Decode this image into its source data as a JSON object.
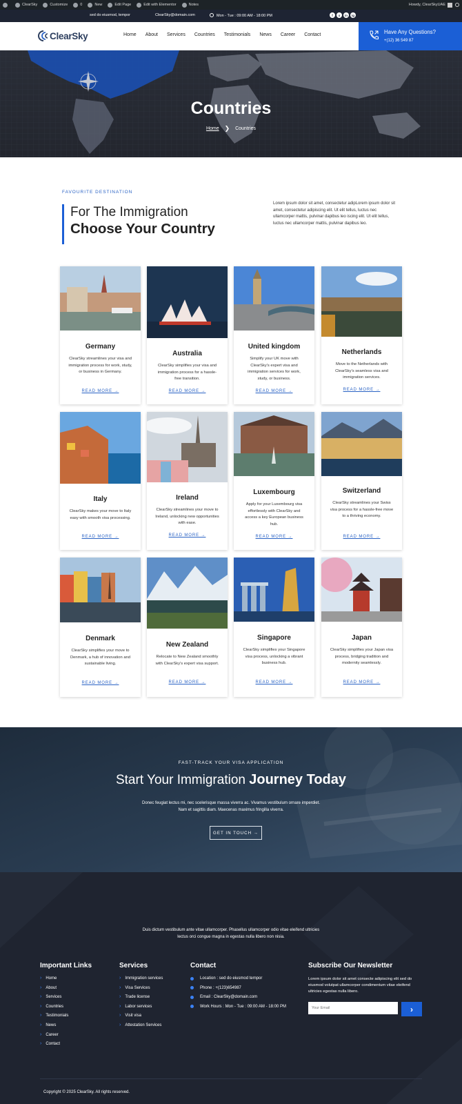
{
  "admin_bar": {
    "items": [
      "ClearSky",
      "Customize",
      "0",
      "New",
      "Edit Page",
      "Edit with Elementor",
      "Notes"
    ],
    "howdy": "Howdy, ClearSkyUAE"
  },
  "top_bar": {
    "tagline": "sed do eiusmod, tempor",
    "email": "ClearSky@domain.com",
    "hours": "Mon - Tue : 09:00 AM - 18:00 PM",
    "socials": [
      "f",
      "x",
      "in",
      "ig"
    ]
  },
  "header": {
    "logo": "ClearSky",
    "nav": [
      "Home",
      "About",
      "Services",
      "Countries",
      "Testimonials",
      "News",
      "Career",
      "Contact"
    ],
    "cta_title": "Have Any Questions?",
    "cta_phone": "+(12) 36 549 87"
  },
  "hero": {
    "title": "Countries",
    "breadcrumb_home": "Home",
    "breadcrumb_current": "Countries"
  },
  "intro": {
    "eyebrow": "FAVOURITE DESTINATION",
    "heading_line1": "For The Immigration",
    "heading_line2": "Choose Your Country",
    "paragraph": "Lorem ipsum dolor sit amet, consectetur adipLorem ipsum dolor sit amet, consectetur adipiscing elit. Ut elit tellus, luctus nec ullamcorper mattis, pulvinar dapibus leo iscing elit. Ut elit tellus, luctus nec ullamcorper mattis, pulvinar dapibus leo."
  },
  "read_more_label": "READ MORE →",
  "countries": [
    {
      "name": "Germany",
      "desc": "ClearSky streamlines your visa and immigration process for work, study, or business in Germany."
    },
    {
      "name": "Australia",
      "desc": "ClearSky simplifies your visa and immigration process for a hassle-free transition."
    },
    {
      "name": "United kingdom",
      "desc": "Simplify your UK move with ClearSky's expert visa and immigration services for work, study, or business."
    },
    {
      "name": "Netherlands",
      "desc": "Move to the Netherlands with ClearSky's seamless visa and immigration services."
    },
    {
      "name": "Italy",
      "desc": "ClearSky makes your move to Italy easy with smooth visa processing."
    },
    {
      "name": "Ireland",
      "desc": "ClearSky streamlines your move to Ireland, unlocking new opportunities with ease."
    },
    {
      "name": "Luxembourg",
      "desc": "Apply for your Luxembourg visa effortlessly with ClearSky and access a key European business hub."
    },
    {
      "name": "Switzerland",
      "desc": "ClearSky streamlines your Swiss visa process for a hassle-free move to a thriving economy."
    },
    {
      "name": "Denmark",
      "desc": "ClearSky simplifies your move to Denmark, a hub of innovation and sustainable living."
    },
    {
      "name": "New Zealand",
      "desc": "Relocate to New Zealand smoothly with ClearSky's expert visa support."
    },
    {
      "name": "Singapore",
      "desc": "ClearSky simplifies your Singapore visa process, unlocking a vibrant business hub."
    },
    {
      "name": "Japan",
      "desc": "ClearSky simplifies your Japan visa process, bridging tradition and modernity seamlessly."
    }
  ],
  "cta": {
    "eyebrow": "FAST-TRACK YOUR VISA APPLICATION",
    "title_regular": "Start Your Immigration",
    "title_bold": "Journey Today",
    "paragraph": "Donec feugiat lectus mi, nec scelerisque massa viverra ac. Vivamus vestibulum ornare imperdiet. Nam et sagittis diam. Maecenas maximus fringilla viverra.",
    "button": "GET IN TOUCH →"
  },
  "footer": {
    "about": "Duis dictum vestibulum ante vitae ullamcorper. Phasellus ullamcorper odio vitae eleifend ultricies lectus orci congue magna in egestas nulla libero non nisia.",
    "links_heading": "Important Links",
    "links": [
      "Home",
      "About",
      "Services",
      "Countries",
      "Testimonials",
      "News",
      "Career",
      "Contact"
    ],
    "services_heading": "Services",
    "services": [
      "Immigration services",
      "Visa Services",
      "Trade license",
      "Labor services",
      "Visit visa",
      "Attestation Services"
    ],
    "contact_heading": "Contact",
    "contact": [
      "Location : sed do eiusmod tempor",
      "Phone : +(123)654987",
      "Email : ClearSky@domain.com",
      "Work Hours : Mon - Tue : 09:00 AM - 18:00 PM"
    ],
    "newsletter_heading": "Subscribe Our Newsletter",
    "newsletter_text": "Lorem ipsum dolor sit amet consecte adipiscing elit sed do eiusmod volutpat ullamcorper condimentum vitae eleifend ultricies egestas nulla libero.",
    "newsletter_placeholder": "Your Email",
    "newsletter_button": "›",
    "copyright": "Copyright © 2025 ClearSky. All rights reserved."
  },
  "colors": {
    "accent": "#1b5fd6",
    "dark": "#1f2430",
    "topbar": "#1e2433"
  }
}
